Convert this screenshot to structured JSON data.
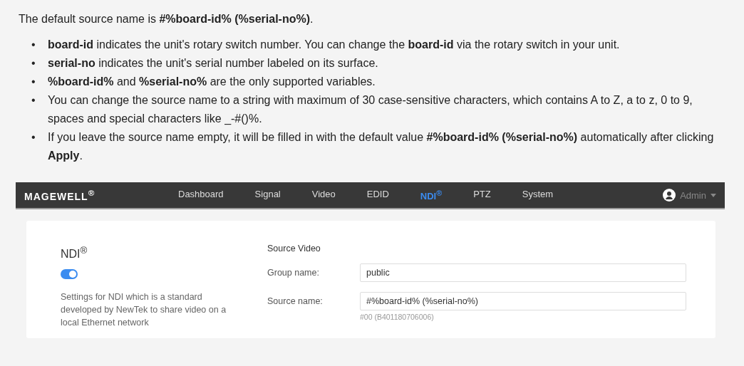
{
  "intro": "The default source name is **#%board-id% (%serial-no%)**.",
  "bullets": [
    {
      "marker": "•",
      "text": "**board-id** indicates the unit's rotary switch number. You can change the **board-id** via the rotary switch in your unit."
    },
    {
      "marker": "•",
      "text": "**serial-no** indicates the unit's serial number labeled on its surface."
    },
    {
      "marker": "•",
      "text": "**%board-id%** and **%serial-no%** are the only supported variables."
    },
    {
      "marker": "•",
      "text": "You can change the source name to a string with maximum of 30 case-sensitive characters, which contains A to Z, a to z, 0 to 9, spaces and special characters like _-#()%."
    },
    {
      "marker": "•",
      "text": "If you leave the source name empty, it will be filled in with the default value **#%board-id% (%serial-no%)** automatically after clicking **Apply**."
    }
  ],
  "app": {
    "logo": "MAGEWELL$^{®}$",
    "nav": [
      {
        "label": "Dashboard",
        "selected": false
      },
      {
        "label": "Signal",
        "selected": false
      },
      {
        "label": "Video",
        "selected": false
      },
      {
        "label": "EDID",
        "selected": false
      },
      {
        "label": "NDI$^{®}$",
        "selected": true
      },
      {
        "label": "PTZ",
        "selected": false
      },
      {
        "label": "System",
        "selected": false
      }
    ],
    "user": "Admin",
    "panel": {
      "title": "NDI$^{®}$",
      "enabled": true,
      "description": "Settings for NDI which is a standard developed by NewTek to share video on a local Ethernet network"
    },
    "section": "Source Video",
    "fields": [
      {
        "label": "Group name:",
        "value": "public"
      },
      {
        "label": "Source name:",
        "value": "#%board-id% (%serial-no%)",
        "hint": "#00 (B401180706006)"
      }
    ]
  }
}
